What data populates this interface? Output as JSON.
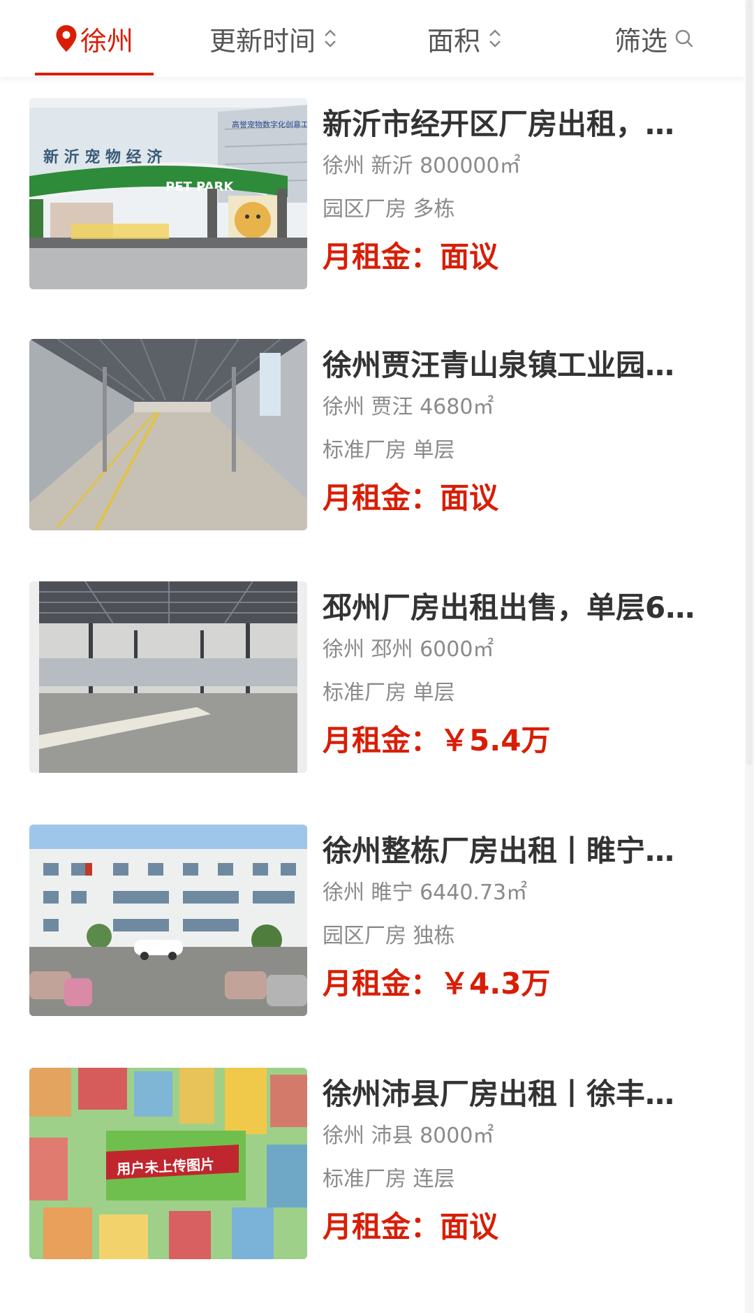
{
  "filters": {
    "city": "徐州",
    "update_time": "更新时间",
    "area": "面积",
    "screen": "筛选"
  },
  "listings": [
    {
      "title": "新沂市经开区厂房出租，…",
      "location": "徐州 新沂 800000㎡",
      "type": "园区厂房 多栋",
      "price_label": "月租金：",
      "price_value": "面议",
      "image_text_top": "新 沂 宠 物 经 济",
      "image_text_sign": "PET PARK",
      "image_text_building": "高誉宠物数字化创意工厂"
    },
    {
      "title": "徐州贾汪青山泉镇工业园…",
      "location": "徐州 贾汪 4680㎡",
      "type": "标准厂房 单层",
      "price_label": "月租金：",
      "price_value": "面议"
    },
    {
      "title": "邳州厂房出租出售，单层6…",
      "location": "徐州 邳州 6000㎡",
      "type": "标准厂房 单层",
      "price_label": "月租金：",
      "price_value": "￥5.4万"
    },
    {
      "title": "徐州整栋厂房出租丨睢宁…",
      "location": "徐州 睢宁 6440.73㎡",
      "type": "园区厂房 独栋",
      "price_label": "月租金：",
      "price_value": "￥4.3万"
    },
    {
      "title": "徐州沛县厂房出租丨徐丰…",
      "location": "徐州 沛县 8000㎡",
      "type": "标准厂房 连层",
      "price_label": "月租金：",
      "price_value": "面议",
      "image_text_placeholder": "用户未上传图片"
    }
  ]
}
